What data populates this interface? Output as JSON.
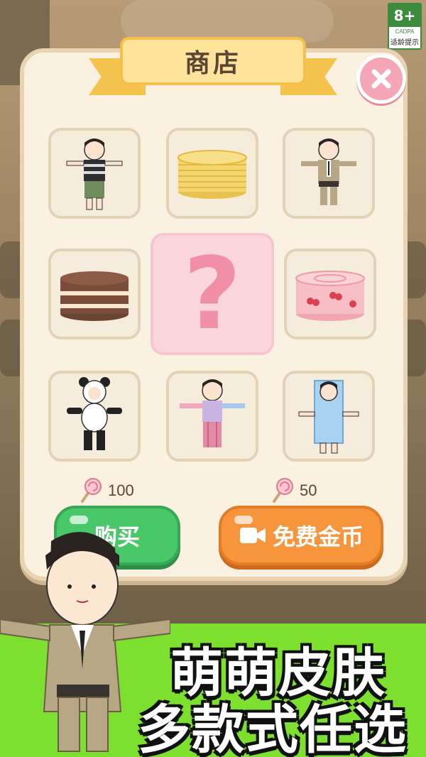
{
  "age_rating": {
    "rating": "8+",
    "org": "CADPA",
    "label": "适龄提示"
  },
  "shop": {
    "title": "商店",
    "items": [
      {
        "name": "striped-shirt-skin"
      },
      {
        "name": "pancake-stack"
      },
      {
        "name": "khaki-suit-skin"
      },
      {
        "name": "chocolate-cake"
      },
      {
        "name": "mystery-item",
        "label": "?"
      },
      {
        "name": "cherry-roll-cake"
      },
      {
        "name": "panda-costume-skin"
      },
      {
        "name": "rainbow-outfit-skin"
      },
      {
        "name": "milk-carton-skin"
      }
    ],
    "prices": [
      {
        "value": "100",
        "icon": "lollipop-icon"
      },
      {
        "value": "50",
        "icon": "lollipop-icon"
      }
    ],
    "buy_label": "购买",
    "free_coins_label": "免费金币"
  },
  "promo": {
    "line1": "萌萌皮肤",
    "line2": "多款式任选"
  },
  "colors": {
    "panel": "#fbf1e0",
    "buy": "#49c86a",
    "coins": "#f7953d",
    "banner": "#7de02e",
    "accent": "#f08fa5"
  }
}
